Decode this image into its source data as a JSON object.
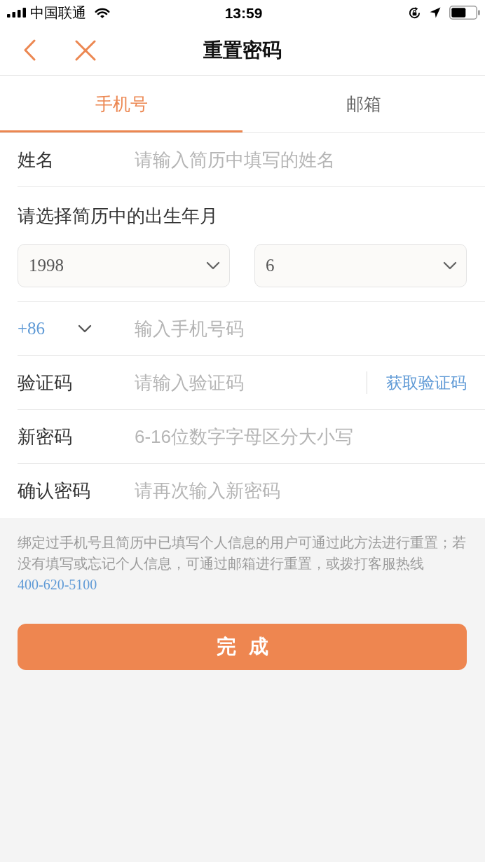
{
  "status_bar": {
    "carrier": "中国联通",
    "time": "13:59"
  },
  "nav_bar": {
    "title": "重置密码"
  },
  "tabs": [
    {
      "label": "手机号",
      "selected": true
    },
    {
      "label": "邮箱",
      "selected": false
    }
  ],
  "form": {
    "name": {
      "label": "姓名",
      "placeholder": "请输入简历中填写的姓名"
    },
    "birth": {
      "label": "请选择简历中的出生年月",
      "year": "1998",
      "month": "6"
    },
    "phone": {
      "country_code": "+86",
      "placeholder": "输入手机号码"
    },
    "code": {
      "label": "验证码",
      "placeholder": "请输入验证码",
      "button": "获取验证码"
    },
    "new_password": {
      "label": "新密码",
      "placeholder": "6-16位数字字母区分大小写"
    },
    "confirm_password": {
      "label": "确认密码",
      "placeholder": "请再次输入新密码"
    }
  },
  "note": {
    "text": "绑定过手机号且简历中已填写个人信息的用户可通过此方法进行重置；若没有填写或忘记个人信息，可通过邮箱进行重置，或拨打客服热线",
    "hotline": "400-620-5100"
  },
  "submit_button": "完成"
}
